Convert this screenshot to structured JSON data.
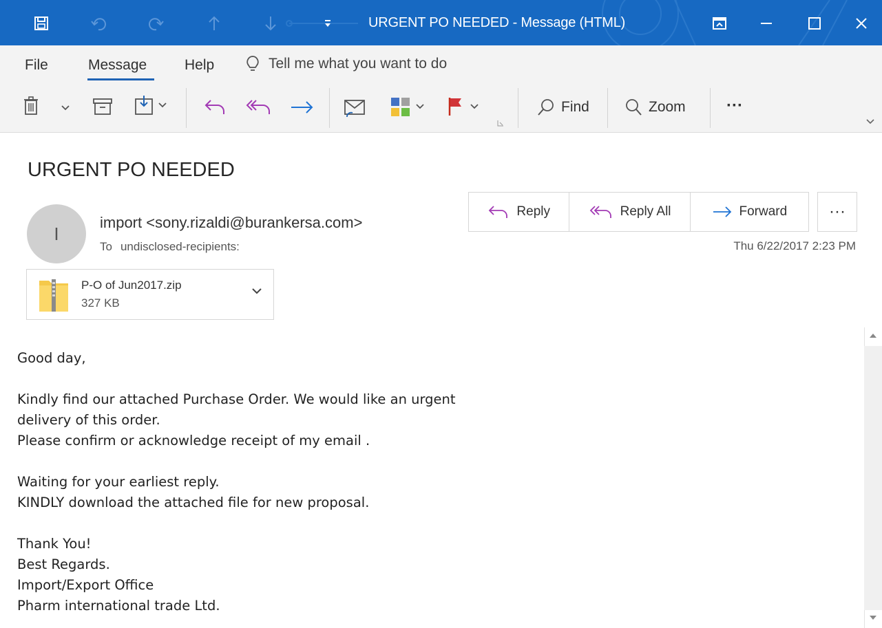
{
  "window": {
    "title": "URGENT PO NEEDED  -  Message (HTML)",
    "accent": "#1769c2"
  },
  "menu": {
    "items": [
      "File",
      "Message",
      "Help"
    ],
    "active": "Message",
    "tell_me": "Tell me what you want to do"
  },
  "toolbar": {
    "find_label": "Find",
    "zoom_label": "Zoom",
    "more_label": "···"
  },
  "email": {
    "subject": "URGENT PO NEEDED",
    "avatar_initial": "I",
    "sender": "import <sony.rizaldi@burankersa.com>",
    "to_label": "To",
    "recipients": "undisclosed-recipients:",
    "date": "Thu 6/22/2017 2:23 PM",
    "actions": {
      "reply": "Reply",
      "reply_all": "Reply All",
      "forward": "Forward",
      "more": "···"
    },
    "attachment": {
      "name": "P-O of  Jun2017.zip",
      "size": "327 KB"
    },
    "body": [
      "Good day,",
      "",
      "Kindly find our attached  Purchase Order. We would like an urgent",
      "delivery of this order.",
      "Please confirm or acknowledge receipt of my email .",
      "",
      "Waiting for your earliest reply.",
      "KINDLY download the attached file for new proposal.",
      "",
      "Thank You!",
      "Best Regards.",
      "Import/Export Office",
      "Pharm international trade Ltd."
    ]
  }
}
